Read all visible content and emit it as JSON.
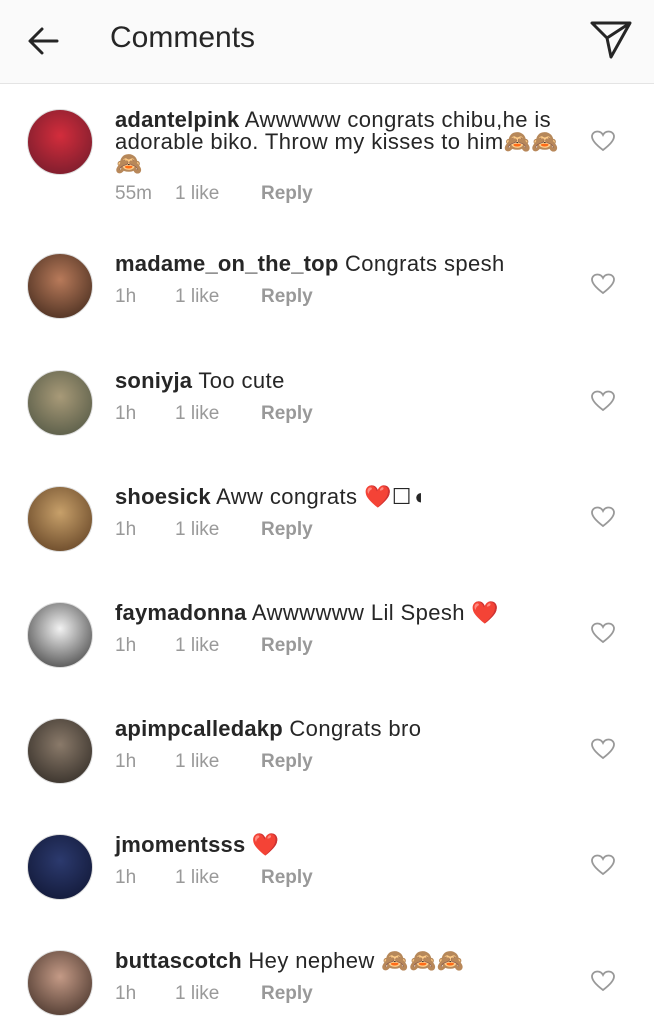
{
  "header": {
    "title": "Comments"
  },
  "comments": [
    {
      "username": "adantelpink",
      "text": "Awwwww congrats chibu,he is adorable biko. Throw my kisses to him🙈🙈🙈",
      "time": "55m",
      "likes": "1 like",
      "reply": "Reply",
      "avatar_colors": [
        "#d32d3c",
        "#6b1a2a"
      ]
    },
    {
      "username": "madame_on_the_top",
      "text": "Congrats spesh",
      "time": "1h",
      "likes": "1 like",
      "reply": "Reply",
      "avatar_colors": [
        "#b87a5a",
        "#3a2418"
      ]
    },
    {
      "username": "soniyja",
      "text": "Too cute",
      "time": "1h",
      "likes": "1 like",
      "reply": "Reply",
      "avatar_colors": [
        "#a89a78",
        "#4b5240"
      ]
    },
    {
      "username": "shoesick",
      "text": "Aww congrats ❤️☐◖",
      "time": "1h",
      "likes": "1 like",
      "reply": "Reply",
      "avatar_colors": [
        "#c7a06a",
        "#5a3a1e"
      ]
    },
    {
      "username": "faymadonna",
      "text": "Awwwwww Lil Spesh ❤️",
      "time": "1h",
      "likes": "1 like",
      "reply": "Reply",
      "avatar_colors": [
        "#f2f2f2",
        "#333333"
      ]
    },
    {
      "username": "apimpcalledakp",
      "text": "Congrats bro",
      "time": "1h",
      "likes": "1 like",
      "reply": "Reply",
      "avatar_colors": [
        "#8a7a6a",
        "#2a2520"
      ]
    },
    {
      "username": "jmomentsss",
      "text": "❤️",
      "time": "1h",
      "likes": "1 like",
      "reply": "Reply",
      "avatar_colors": [
        "#2c3a6e",
        "#0e1430"
      ]
    },
    {
      "username": "buttascotch",
      "text": "Hey nephew 🙈🙈🙈",
      "time": "1h",
      "likes": "1 like",
      "reply": "Reply",
      "avatar_colors": [
        "#c49a86",
        "#3b2a22"
      ]
    }
  ]
}
